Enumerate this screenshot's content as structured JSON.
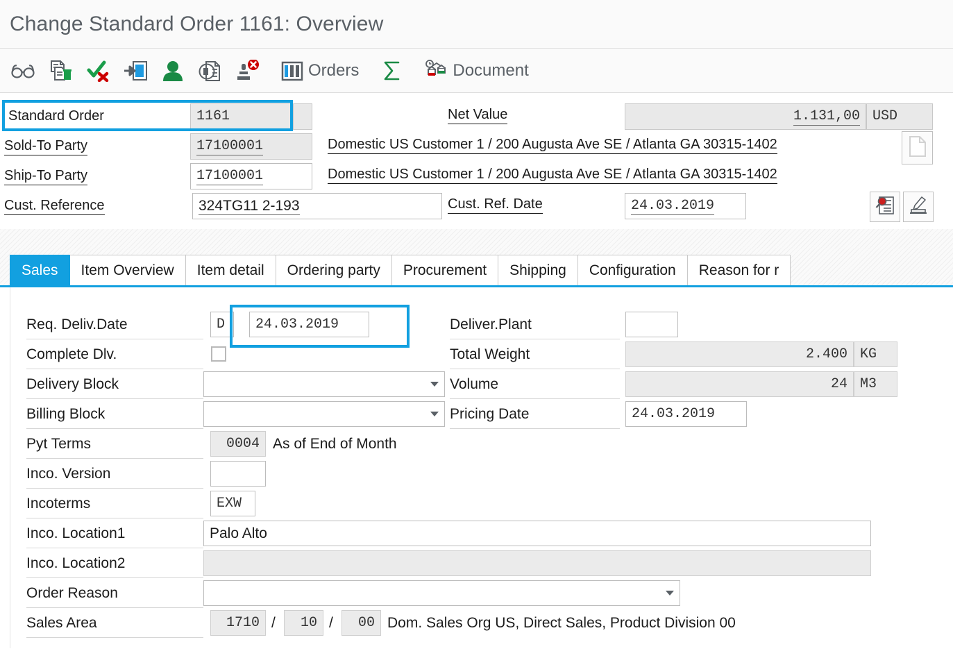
{
  "window": {
    "title": "Change Standard Order 1161: Overview"
  },
  "toolbar": {
    "items": [
      {
        "name": "display-mode-icon",
        "icon": "glasses-icon",
        "label": ""
      },
      {
        "name": "copy-document-icon",
        "icon": "document-copy-icon",
        "label": ""
      },
      {
        "name": "check-incomplete-icon",
        "icon": "check-cross-icon",
        "label": ""
      },
      {
        "name": "enter-icon",
        "icon": "enter-arrow-icon",
        "label": ""
      },
      {
        "name": "partner-icon",
        "icon": "person-icon",
        "label": ""
      },
      {
        "name": "availability-icon",
        "icon": "document-circle-icon",
        "label": ""
      },
      {
        "name": "reject-icon",
        "icon": "stamp-reject-icon",
        "label": ""
      },
      {
        "name": "orders-button",
        "icon": "orders-columns-icon",
        "label": "Orders"
      },
      {
        "name": "sum-button",
        "icon": "sigma-icon",
        "label": ""
      },
      {
        "name": "document-button",
        "icon": "document-flow-icon",
        "label": "Document"
      }
    ]
  },
  "header": {
    "order": {
      "label": "Standard Order",
      "value": "1161"
    },
    "net_value": {
      "label": "Net Value",
      "value": "1.131,00",
      "currency": "USD"
    },
    "sold_to": {
      "label": "Sold-To Party",
      "value": "17100001",
      "description": "Domestic US Customer 1 / 200 Augusta Ave SE / Atlanta GA 30315-1402"
    },
    "ship_to": {
      "label": "Ship-To Party",
      "value": "17100001",
      "description": "Domestic US Customer 1 / 200 Augusta Ave SE / Atlanta GA 30315-1402"
    },
    "cust_reference": {
      "label": "Cust. Reference",
      "value": "324TG11 2-193"
    },
    "cust_ref_date": {
      "label": "Cust. Ref. Date",
      "value": "24.03.2019"
    },
    "buttons": {
      "document_sheet": "sheet-icon",
      "display_doc_header": "search-document-icon",
      "texts": "texts-icon"
    }
  },
  "tabs": [
    {
      "label": "Sales",
      "active": true
    },
    {
      "label": "Item Overview",
      "active": false
    },
    {
      "label": "Item detail",
      "active": false
    },
    {
      "label": "Ordering party",
      "active": false
    },
    {
      "label": "Procurement",
      "active": false
    },
    {
      "label": "Shipping",
      "active": false
    },
    {
      "label": "Configuration",
      "active": false
    },
    {
      "label": "Reason for r",
      "active": false
    }
  ],
  "sales": {
    "req_deliv_date": {
      "label": "Req. Deliv.Date",
      "type": "D",
      "value": "24.03.2019"
    },
    "deliver_plant": {
      "label": "Deliver.Plant",
      "value": ""
    },
    "complete_dlv": {
      "label": "Complete Dlv.",
      "checked": false
    },
    "total_weight": {
      "label": "Total Weight",
      "value": "2.400",
      "unit": "KG"
    },
    "delivery_block": {
      "label": "Delivery Block",
      "value": ""
    },
    "volume": {
      "label": "Volume",
      "value": "24",
      "unit": "M3"
    },
    "billing_block": {
      "label": "Billing Block",
      "value": ""
    },
    "pricing_date": {
      "label": "Pricing Date",
      "value": "24.03.2019"
    },
    "pyt_terms": {
      "label": "Pyt Terms",
      "value": "0004",
      "description": "As of End of Month"
    },
    "inco_version": {
      "label": "Inco. Version",
      "value": ""
    },
    "incoterms": {
      "label": "Incoterms",
      "value": "EXW"
    },
    "inco_location1": {
      "label": "Inco. Location1",
      "value": "Palo Alto"
    },
    "inco_location2": {
      "label": "Inco. Location2",
      "value": ""
    },
    "order_reason": {
      "label": "Order Reason",
      "value": ""
    },
    "sales_area": {
      "label": "Sales Area",
      "org": "1710",
      "channel": "10",
      "division": "00",
      "sep": "/",
      "description": "Dom. Sales Org US, Direct Sales, Product Division 00"
    }
  },
  "colors": {
    "accent": "#12a0e0",
    "title_text": "#5a6066",
    "field_readonly_bg": "#e9e9e9",
    "green": "#007a33",
    "red": "#cc0000"
  }
}
